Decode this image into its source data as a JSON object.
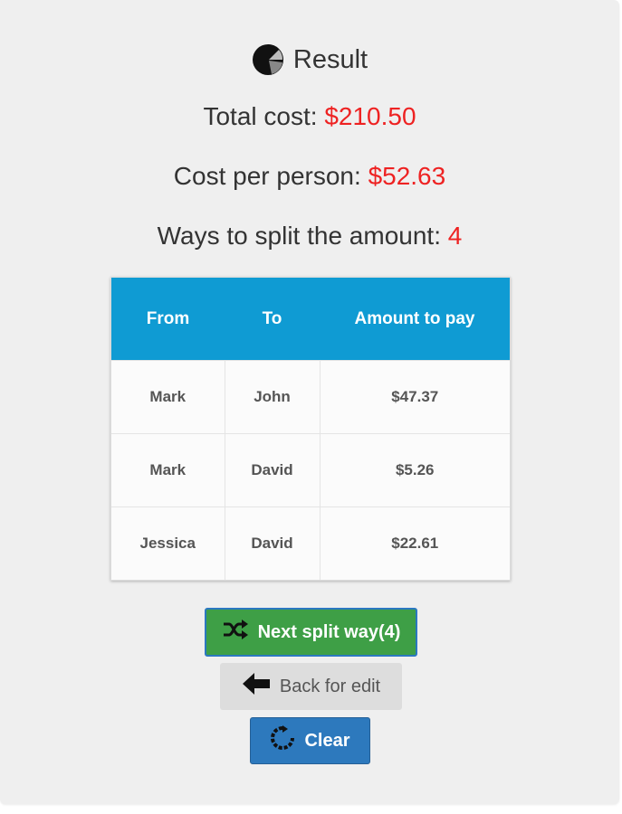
{
  "result": {
    "title": "Result",
    "title_icon": "pie-chart-icon",
    "total_cost_label": "Total cost:",
    "total_cost_value": "$210.50",
    "per_person_label": "Cost per person:",
    "per_person_value": "$52.63",
    "ways_label": "Ways to split the amount:",
    "ways_value": "4"
  },
  "table": {
    "headers": [
      "From",
      "To",
      "Amount to pay"
    ],
    "rows": [
      [
        "Mark",
        "John",
        "$47.37"
      ],
      [
        "Mark",
        "David",
        "$5.26"
      ],
      [
        "Jessica",
        "David",
        "$22.61"
      ]
    ]
  },
  "buttons": {
    "next_label": "Next split way(4)",
    "next_icon": "shuffle-icon",
    "back_label": "Back for edit",
    "back_icon": "arrow-left-icon",
    "clear_label": "Clear",
    "clear_icon": "refresh-icon"
  },
  "colors": {
    "accent_value": "#ee2222",
    "table_header": "#0f9bd3",
    "next_button": "#3e9f46",
    "back_button": "#dddddd",
    "clear_button": "#2d79bd"
  }
}
